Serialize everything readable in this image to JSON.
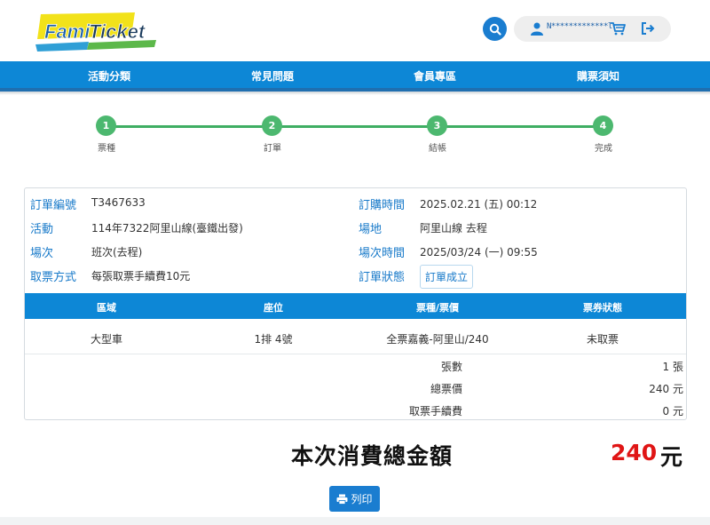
{
  "header": {
    "logo_text": "FamiTicket",
    "user_name": "N*************l",
    "icons": [
      "search-icon",
      "user-icon",
      "cart-icon",
      "logout-icon"
    ]
  },
  "nav": {
    "items": [
      "活動分類",
      "常見問題",
      "會員專區",
      "購票須知"
    ]
  },
  "steps": [
    {
      "num": "1",
      "label": "票種"
    },
    {
      "num": "2",
      "label": "訂單"
    },
    {
      "num": "3",
      "label": "結帳"
    },
    {
      "num": "4",
      "label": "完成"
    }
  ],
  "order": {
    "order_no_label": "訂單編號",
    "order_no": "T3467633",
    "event_label": "活動",
    "event": "114年7322阿里山線(臺鐵出發)",
    "session_label": "場次",
    "session": "班次(去程)",
    "pickup_label": "取票方式",
    "pickup": "每張取票手續費10元",
    "order_time_label": "訂購時間",
    "order_time": "2025.02.21 (五) 00:12",
    "venue_label": "場地",
    "venue": "阿里山線 去程",
    "session_time_label": "場次時間",
    "session_time": "2025/03/24 (一) 09:55",
    "status_label": "訂單狀態",
    "status": "訂單成立"
  },
  "table": {
    "headers": [
      "區域",
      "座位",
      "票種/票價",
      "票券狀態"
    ],
    "rows": [
      [
        "大型車",
        "1排 4號",
        "全票嘉義-阿里山/240",
        "未取票"
      ]
    ]
  },
  "summary": [
    {
      "label": "張數",
      "value": "1 張"
    },
    {
      "label": "總票價",
      "value": "240 元"
    },
    {
      "label": "取票手續費",
      "value": "0 元"
    }
  ],
  "total": {
    "label": "本次消費總金額",
    "amount": "240",
    "unit": "元"
  },
  "print_label": "列印",
  "colors": {
    "brand_blue": "#0d87d6",
    "step_green": "#4cb86f",
    "total_red": "#e01515"
  }
}
